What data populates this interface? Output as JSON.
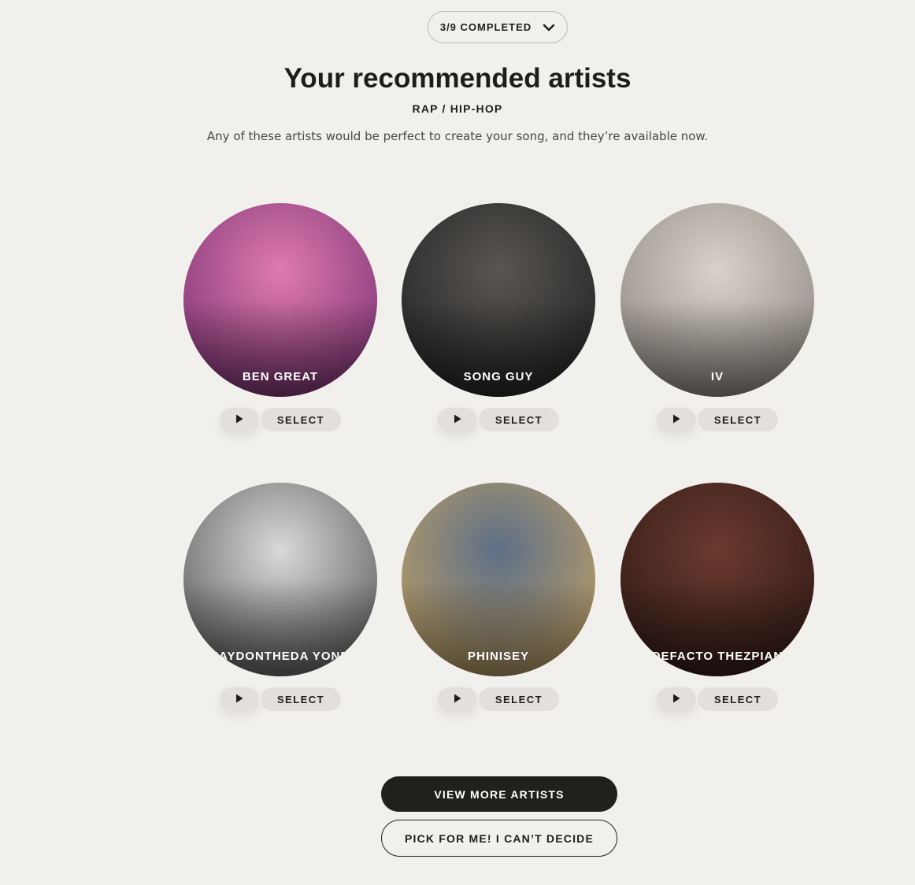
{
  "progress": {
    "label": "3/9 COMPLETED",
    "icon": "chevron-down-icon"
  },
  "header": {
    "title": "Your recommended artists",
    "genre": "RAP / HIP-HOP",
    "subtitle": "Any of these artists would be perfect to create your song, and they’re available now."
  },
  "artists": [
    {
      "name": "BEN GREAT",
      "select_label": "SELECT",
      "play_icon": "play-icon",
      "bg": "#8a3e7c",
      "bg2": "#e07ab0"
    },
    {
      "name": "SONG GUY",
      "select_label": "SELECT",
      "play_icon": "play-icon",
      "bg": "#2a2a2c",
      "bg2": "#5a5650"
    },
    {
      "name": "IV",
      "select_label": "SELECT",
      "play_icon": "play-icon",
      "bg": "#9a948c",
      "bg2": "#d8d3ca"
    },
    {
      "name": "JAYDONTHEDA YONE",
      "select_label": "SELECT",
      "play_icon": "play-icon",
      "bg": "#6e6e6e",
      "bg2": "#d9d9d9"
    },
    {
      "name": "PHINISEY",
      "select_label": "SELECT",
      "play_icon": "play-icon",
      "bg": "#b29a6a",
      "bg2": "#5d6f88"
    },
    {
      "name": "DEFACTO THEZPIAN",
      "select_label": "SELECT",
      "play_icon": "play-icon",
      "bg": "#3a1f1a",
      "bg2": "#6a3a2f"
    }
  ],
  "actions": {
    "view_more": "VIEW MORE ARTISTS",
    "pick_for_me": "PICK FOR ME! I CAN’T DECIDE"
  }
}
